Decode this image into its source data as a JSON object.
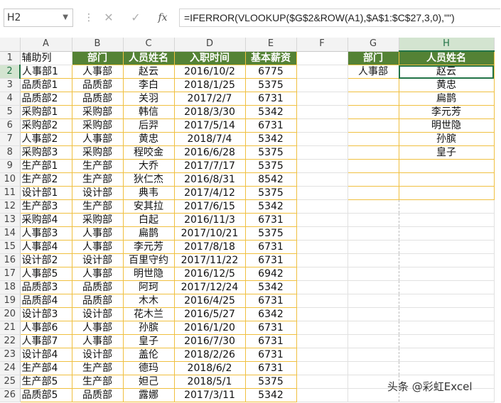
{
  "namebox": "H2",
  "formula": "=IFERROR(VLOOKUP($G$2&ROW(A1),$A$1:$C$27,3,0),\"\")",
  "fx": "fx",
  "columns": [
    "A",
    "B",
    "C",
    "D",
    "E",
    "F",
    "G",
    "H"
  ],
  "headers": {
    "A": "辅助列",
    "B": "部门",
    "C": "人员姓名",
    "D": "入职时间",
    "E": "基本薪资",
    "G": "部门",
    "H": "人员姓名"
  },
  "rows": [
    [
      "人事部1",
      "人事部",
      "赵云",
      "2016/10/2",
      "6775"
    ],
    [
      "品质部1",
      "品质部",
      "李白",
      "2018/1/25",
      "5375"
    ],
    [
      "品质部2",
      "品质部",
      "关羽",
      "2017/2/7",
      "6731"
    ],
    [
      "采购部1",
      "采购部",
      "韩信",
      "2018/3/30",
      "5342"
    ],
    [
      "采购部2",
      "采购部",
      "后羿",
      "2017/5/14",
      "6731"
    ],
    [
      "人事部2",
      "人事部",
      "黄忠",
      "2018/7/4",
      "5342"
    ],
    [
      "采购部3",
      "采购部",
      "程咬金",
      "2016/6/28",
      "5375"
    ],
    [
      "生产部1",
      "生产部",
      "大乔",
      "2017/7/17",
      "5375"
    ],
    [
      "生产部2",
      "生产部",
      "狄仁杰",
      "2016/8/31",
      "8542"
    ],
    [
      "设计部1",
      "设计部",
      "典韦",
      "2017/4/12",
      "5375"
    ],
    [
      "生产部3",
      "生产部",
      "安其拉",
      "2017/6/15",
      "5342"
    ],
    [
      "采购部4",
      "采购部",
      "白起",
      "2016/11/3",
      "6731"
    ],
    [
      "人事部3",
      "人事部",
      "扁鹊",
      "2017/10/21",
      "5375"
    ],
    [
      "人事部4",
      "人事部",
      "李元芳",
      "2017/8/18",
      "6731"
    ],
    [
      "设计部2",
      "设计部",
      "百里守约",
      "2017/11/22",
      "6731"
    ],
    [
      "人事部5",
      "人事部",
      "明世隐",
      "2016/12/5",
      "6942"
    ],
    [
      "品质部3",
      "品质部",
      "阿珂",
      "2017/12/24",
      "5342"
    ],
    [
      "品质部4",
      "品质部",
      "木木",
      "2016/4/25",
      "6731"
    ],
    [
      "设计部3",
      "设计部",
      "花木兰",
      "2016/5/27",
      "6342"
    ],
    [
      "人事部6",
      "人事部",
      "孙膑",
      "2016/1/20",
      "6731"
    ],
    [
      "人事部7",
      "人事部",
      "皇子",
      "2016/7/30",
      "6731"
    ],
    [
      "设计部4",
      "设计部",
      "盖伦",
      "2018/2/26",
      "6731"
    ],
    [
      "生产部4",
      "生产部",
      "德玛",
      "2018/6/2",
      "6731"
    ],
    [
      "生产部5",
      "生产部",
      "妲己",
      "2018/5/1",
      "5375"
    ],
    [
      "品质部5",
      "品质部",
      "露娜",
      "2017/3/11",
      "5342"
    ]
  ],
  "lookup_dept": "人事部",
  "lookup_results": [
    "赵云",
    "黄忠",
    "扁鹊",
    "李元芳",
    "明世隐",
    "孙膑",
    "皇子"
  ],
  "watermark": "头条 @彩虹Excel",
  "colors": {
    "header_green": "#548235",
    "border_yellow": "#f0c040",
    "select_green": "#217346"
  }
}
